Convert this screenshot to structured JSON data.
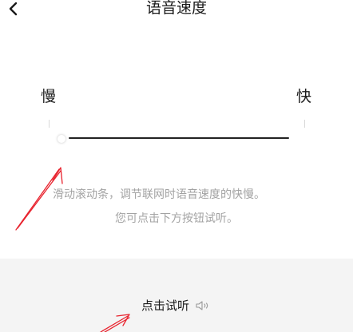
{
  "header": {
    "title": "语音速度",
    "back_icon": "chevron-left-icon"
  },
  "speed_slider": {
    "min_label": "慢",
    "max_label": "快",
    "value_fraction": 0.0
  },
  "hint": {
    "line1": "滑动滚动条，调节联网时语音速度的快慢。",
    "line2": "您可点击下方按钮试听。"
  },
  "listen": {
    "label": "点击试听",
    "icon": "speaker-icon"
  },
  "colors": {
    "text": "#1a1a1a",
    "hint": "#a3a3a3",
    "panel": "#f4f4f4",
    "track": "#222222",
    "annotation": "#e8232e"
  }
}
